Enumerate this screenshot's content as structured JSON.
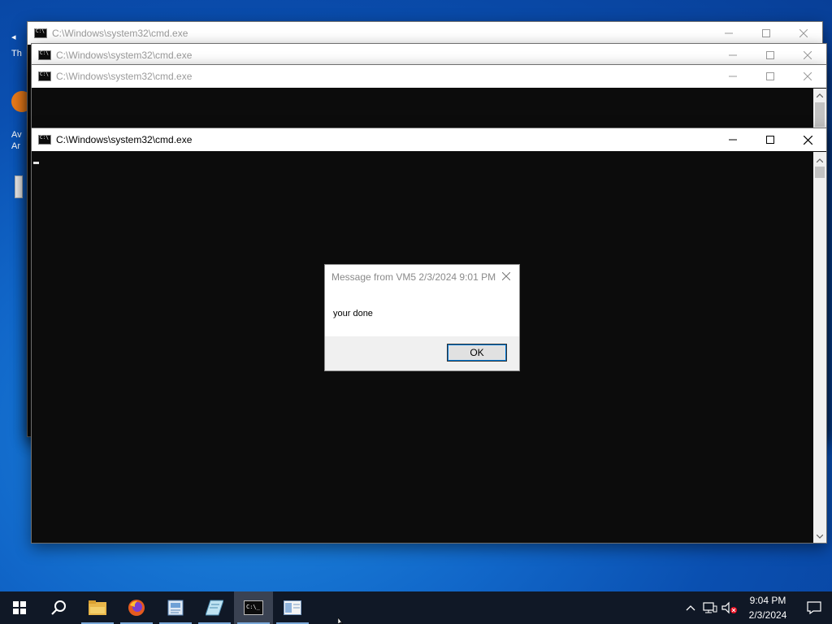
{
  "desktop": {
    "icon_labels": [
      "Th",
      "Av",
      "Ar"
    ]
  },
  "windows": [
    {
      "title": "C:\\Windows\\system32\\cmd.exe"
    },
    {
      "title": "C:\\Windows\\system32\\cmd.exe"
    },
    {
      "title": "C:\\Windows\\system32\\cmd.exe"
    },
    {
      "title": "C:\\Windows\\system32\\cmd.exe"
    }
  ],
  "dialog": {
    "title": "Message from VM5 2/3/2024 9:01 PM",
    "message": "your done",
    "ok_label": "OK"
  },
  "taskbar": {
    "apps": [
      "start-icon",
      "search-icon",
      "file-explorer-icon",
      "firefox-icon",
      "notepad-like-icon",
      "paint-icon",
      "cmd-icon",
      "app-window-icon"
    ],
    "clock_time": "9:04 PM",
    "clock_date": "2/3/2024"
  },
  "colors": {
    "console_bg": "#0c0c0c",
    "titlebar_bg": "#ffffff",
    "taskbar_bg": "#101826",
    "accent": "#0078d7"
  }
}
